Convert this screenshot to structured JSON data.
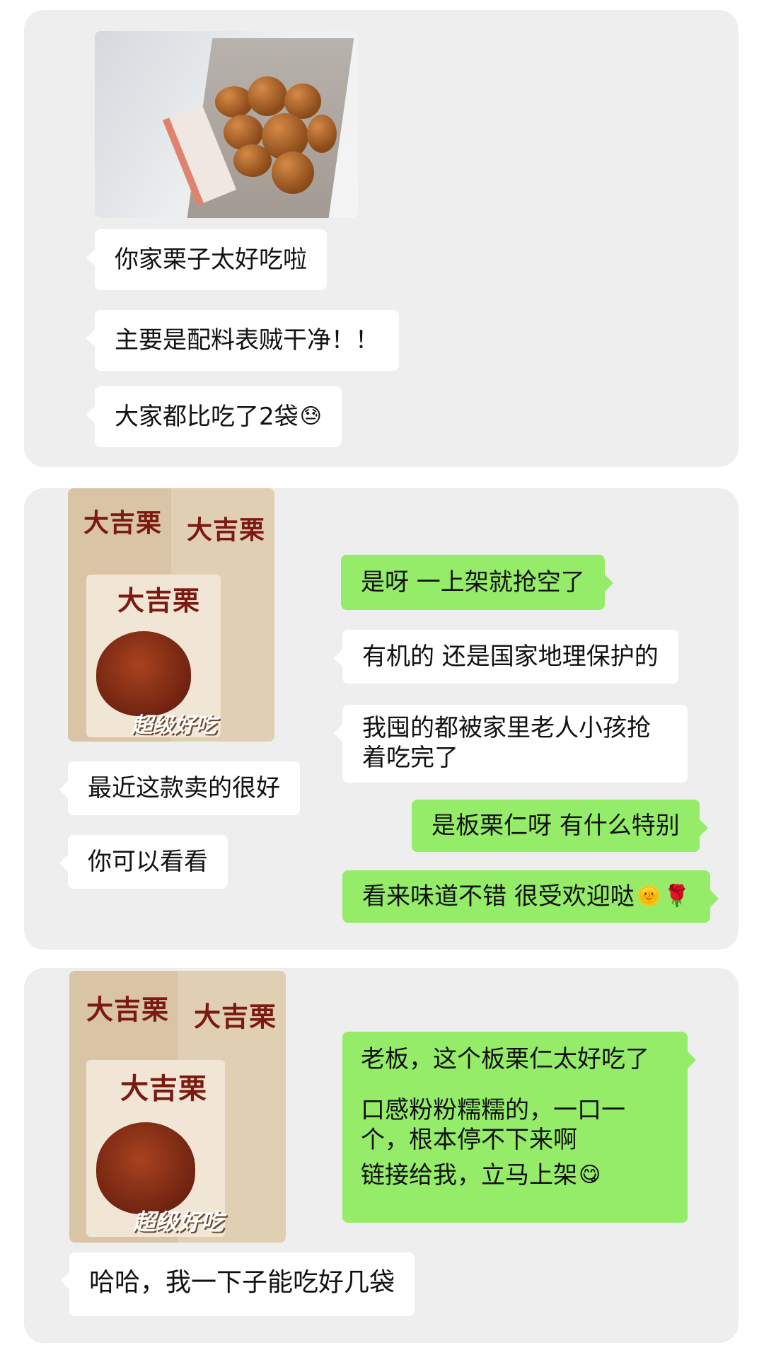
{
  "chat1": {
    "messages": [
      {
        "text": "你家栗子太好吃啦"
      },
      {
        "text": "主要是配料表贼干净！！"
      },
      {
        "text": "大家都比吃了2袋",
        "emoji": "😓"
      }
    ]
  },
  "chat2": {
    "product_brand": "大吉栗",
    "product_slogan": "超级好吃",
    "incoming": [
      {
        "text": "最近这款卖的很好"
      },
      {
        "text": "你可以看看"
      }
    ],
    "outgoing": [
      {
        "text": "是呀  一上架就抢空了"
      },
      {
        "text": "有机的 还是国家地理保护的"
      },
      {
        "text": "我囤的都被家里老人小孩抢着吃完了"
      },
      {
        "text": "是板栗仁呀 有什么特别"
      },
      {
        "text": "看来味道不错  很受欢迎哒",
        "emojis": [
          "🌞",
          "🌹"
        ]
      }
    ]
  },
  "chat3": {
    "product_brand": "大吉栗",
    "product_slogan": "超级好吃",
    "outgoing_lines": [
      "老板，这个板栗仁太好吃了",
      "口感粉粉糯糯的，一口一个，根本停不下来啊",
      "链接给我，立马上架"
    ],
    "outgoing_emoji": "😋",
    "incoming": {
      "text": "哈哈，我一下子能吃好几袋"
    }
  }
}
